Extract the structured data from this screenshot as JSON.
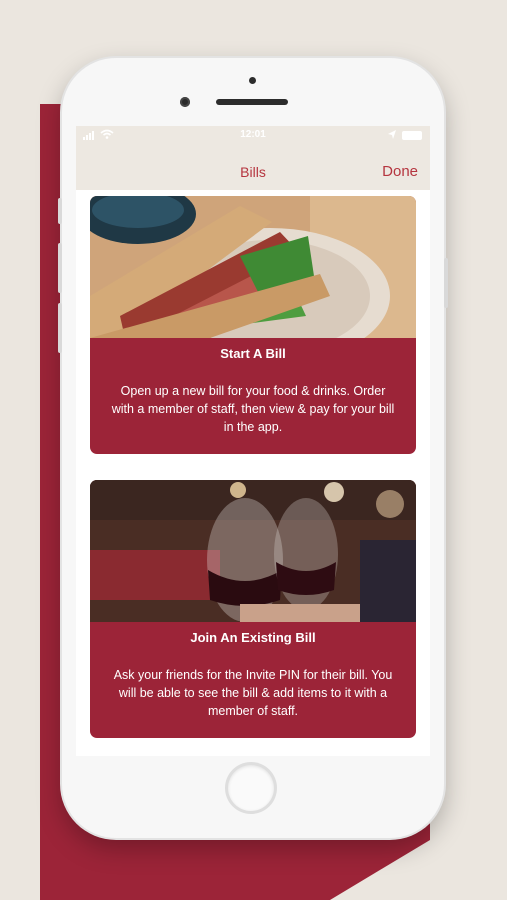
{
  "colors": {
    "background": "#ebe6df",
    "accent": "#9c2438",
    "nav_tint": "#b5353f",
    "nav_bar": "#ede8e1"
  },
  "status_bar": {
    "time": "12:01"
  },
  "nav": {
    "title": "Bills",
    "done_label": "Done"
  },
  "cards": [
    {
      "image": "steak-sandwich-photo",
      "title": "Start A Bill",
      "description": "Open up a new bill for your food & drinks. Order with a member of staff, then view & pay for your bill in the app."
    },
    {
      "image": "red-wine-glasses-photo",
      "title": "Join An Existing Bill",
      "description": "Ask your friends for the Invite PIN for their bill. You will be able to see the bill & add items to it with a member of staff."
    }
  ]
}
